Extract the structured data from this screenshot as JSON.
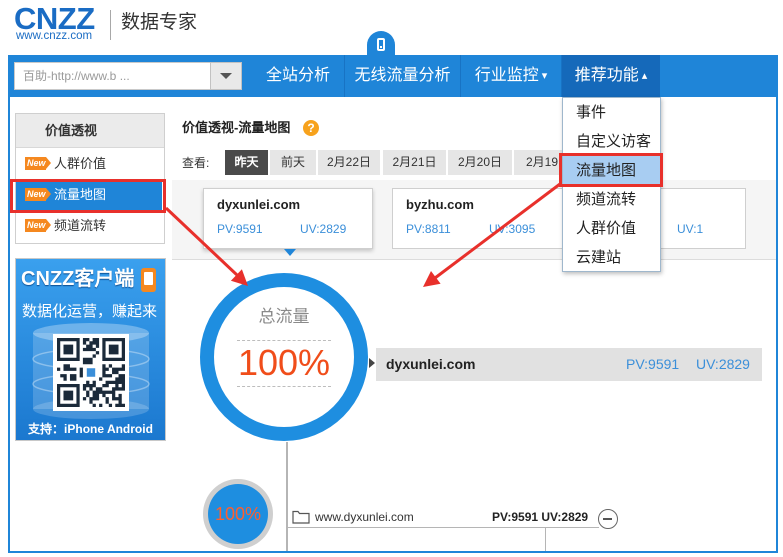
{
  "header": {
    "logo_main": "CNZZ",
    "logo_sub": "www.cnzz.com",
    "product_name": "数据专家"
  },
  "nav": {
    "search_value": "百助-http://www.b ...",
    "items": [
      {
        "label": "全站分析"
      },
      {
        "label": "无线流量分析"
      },
      {
        "label": "行业监控",
        "caret": "▾"
      },
      {
        "label": "推荐功能",
        "caret": "▴",
        "active": true
      }
    ]
  },
  "dropdown": {
    "items": [
      "事件",
      "自定义访客",
      "流量地图",
      "频道流转",
      "人群价值",
      "云建站"
    ],
    "selected_index": 2
  },
  "sidebar": {
    "title": "价值透视",
    "badge": "New",
    "items": [
      "人群价值",
      "流量地图",
      "频道流转"
    ],
    "selected_index": 1
  },
  "promo": {
    "title": "CNZZ客户端",
    "slogan": "数据化运营，赚起来",
    "support": "支持：iPhone Android"
  },
  "main": {
    "title": "价值透视-流量地图",
    "help": "?",
    "view_label": "查看:",
    "date_tabs": [
      "昨天",
      "前天",
      "2月22日",
      "2月21日",
      "2月20日",
      "2月19"
    ],
    "selected_tab_index": 0,
    "sites": [
      {
        "name": "dyxunlei.com",
        "pv": "PV:9591",
        "uv": "UV:2829"
      },
      {
        "name": "byzhu.com",
        "pv": "PV:8811",
        "uv": "UV:3095"
      },
      {
        "uv": "UV:1"
      }
    ],
    "selected_site_index": 0
  },
  "flow": {
    "total_label": "总流量",
    "total_pct": "100%",
    "root": {
      "name": "dyxunlei.com",
      "pv": "PV:9591",
      "uv": "UV:2829"
    },
    "child": {
      "pct": "100%",
      "name": "www.dyxunlei.com",
      "pv": "PV:9591",
      "uv": "UV:2829"
    }
  },
  "colors": {
    "brand_blue": "#1f85d8",
    "nav_active": "#1569ba",
    "new_badge": "#f5881f",
    "percent_text": "#f04d1a",
    "annotation_red": "#e8302b",
    "link_blue": "#3b8fd9",
    "selected_tab": "#4a4a4a"
  },
  "icons": {
    "mobile_tab": "mobile-icon",
    "search_dropdown": "caret-down-icon",
    "help": "help-icon",
    "new_badge": "new-badge-icon",
    "promo_phone": "phone-icon",
    "qr": "qr-code-icon",
    "folder": "folder-icon",
    "collapse": "minus-circle-icon"
  }
}
